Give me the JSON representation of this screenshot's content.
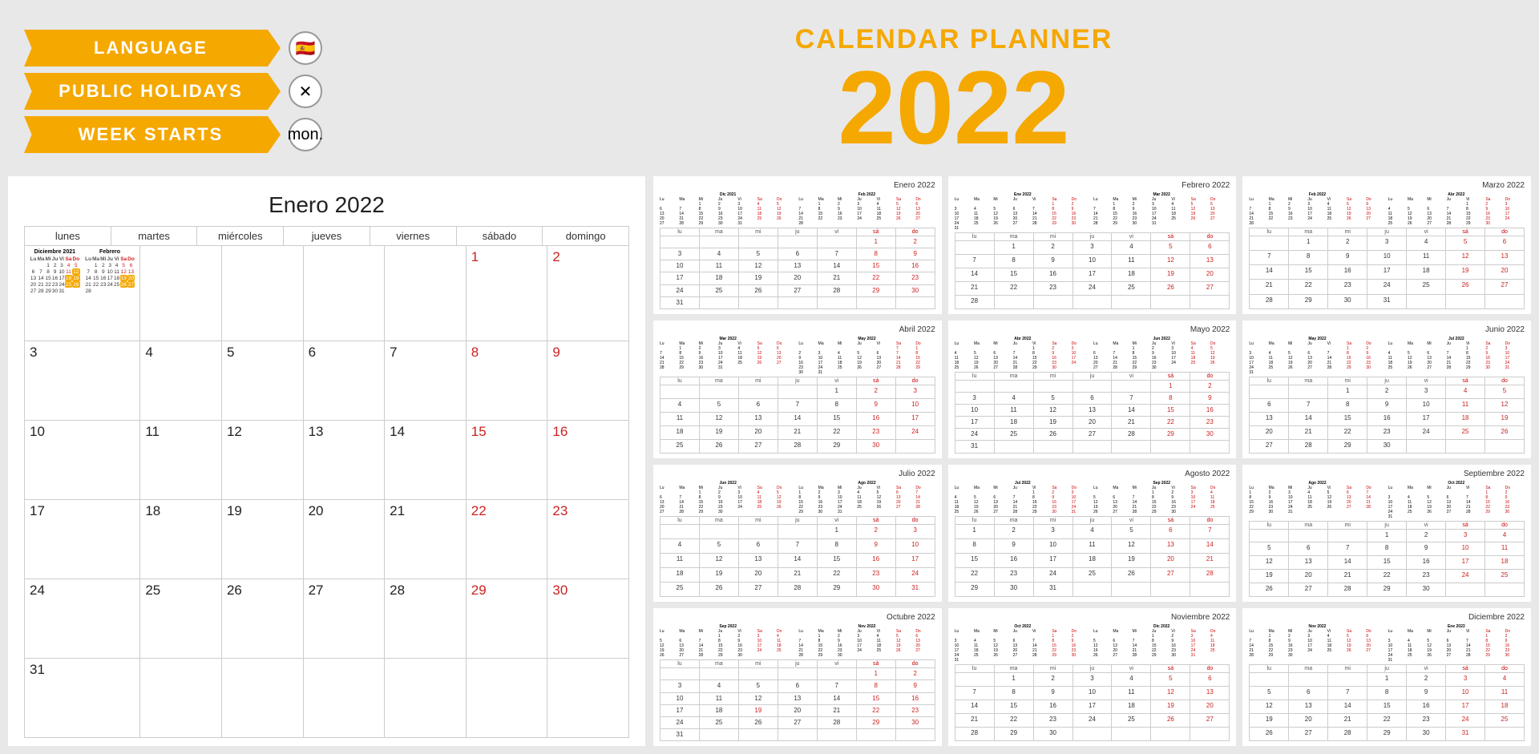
{
  "header": {
    "title": "CALENDAR PLANNER 2022",
    "year": "2022",
    "subtitle": "CALENDAR PLANNER",
    "language_label": "LANGUAGE",
    "holidays_label": "PUBLIC HOLIDAYS",
    "week_starts_label": "WEEK STARTS",
    "language_icon": "🇪🇸",
    "holidays_icon": "✕",
    "week_starts_icon": "mon.",
    "accent_color": "#f5a800"
  },
  "large_calendar": {
    "title": "Enero 2022",
    "day_headers": [
      "lunes",
      "martes",
      "miércoles",
      "jueves",
      "viernes",
      "sábado",
      "domingo"
    ]
  },
  "months": [
    {
      "name": "Enero 2022",
      "short": "ene"
    },
    {
      "name": "Febrero 2022",
      "short": "feb"
    },
    {
      "name": "Marzo 2022",
      "short": "mar"
    },
    {
      "name": "Abril 2022",
      "short": "abr"
    },
    {
      "name": "Mayo 2022",
      "short": "may"
    },
    {
      "name": "Junio 2022",
      "short": "jun"
    },
    {
      "name": "Julio 2022",
      "short": "jul"
    },
    {
      "name": "Agosto 2022",
      "short": "ago"
    },
    {
      "name": "Septiembre 2022",
      "short": "sep"
    },
    {
      "name": "Octubre 2022",
      "short": "oct"
    },
    {
      "name": "Noviembre 2022",
      "short": "nov"
    },
    {
      "name": "Diciembre 2022",
      "short": "dic"
    }
  ]
}
